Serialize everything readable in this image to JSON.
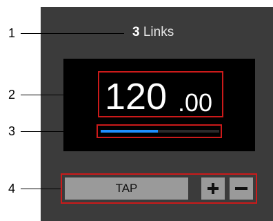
{
  "header": {
    "links_count": "3",
    "links_label": " Links"
  },
  "tempo": {
    "integer": "120",
    "decimal": ".00"
  },
  "beat_progress": {
    "fill_fraction": 0.48,
    "color": "#1e90ff"
  },
  "controls": {
    "tap_label": "TAP",
    "plus_label": "+",
    "minus_label": "−"
  },
  "callouts": [
    "1",
    "2",
    "3",
    "4"
  ],
  "colors": {
    "panel": "#3b3b3b",
    "display": "#000000",
    "highlight": "#cc1a1a",
    "button": "#9a9a9a"
  }
}
